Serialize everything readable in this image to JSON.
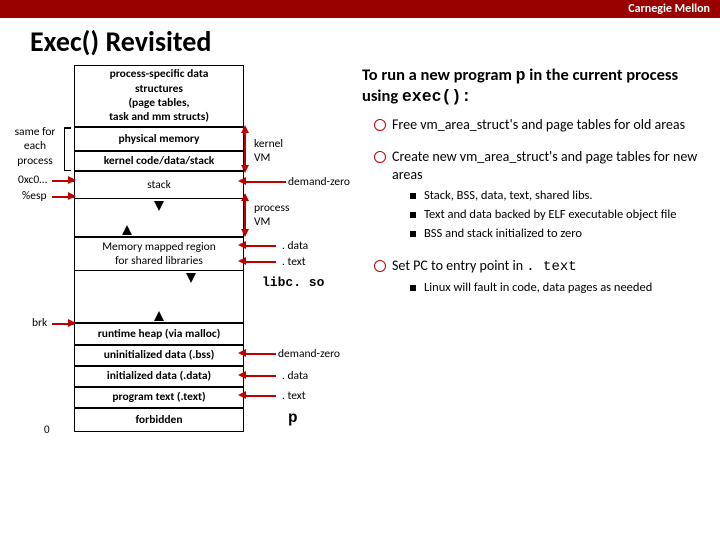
{
  "brand": "Carnegie Mellon",
  "title": "Exec() Revisited",
  "left": {
    "kvm_l1": "process-specific data",
    "kvm_l2": "structures",
    "kvm_l3": "(page tables,",
    "kvm_l4": "task and mm structs)",
    "phys": "physical memory",
    "kcds": "kernel code/data/stack",
    "ustack": "stack",
    "mmap_l1": "Memory mapped region",
    "mmap_l2": "for shared libraries",
    "heap": "runtime heap (via malloc)",
    "bss": "uninitialized data (.bss)",
    "data": "initialized data (.data)",
    "text": "program text (.text)",
    "forb": "forbidden",
    "same_for_label_l1": "same for",
    "same_for_label_l2": "each",
    "same_for_label_l3": "process",
    "oxc": "0xc0…",
    "esp": "%esp",
    "brk": "brk",
    "zero": "0",
    "kvm_label_l1": "kernel",
    "kvm_label_l2": "VM",
    "proc_label_l1": "process",
    "proc_label_l2": "VM",
    "dz": "demand-zero",
    "rdata": ". data",
    "rtext": ". text",
    "libc": "libc. so",
    "p": "p"
  },
  "right": {
    "hdr_pre": "To run a new program ",
    "hdr_p": "p",
    "hdr_mid": " in the current process using ",
    "hdr_exec": "exec():",
    "b1": "Free vm_area_struct's and page tables for old areas",
    "b2": "Create new vm_area_struct's and page tables for new areas",
    "b2a": "Stack, BSS, data, text, shared libs.",
    "b2b": "Text and data backed by ELF executable object file",
    "b2c": "BSS and stack initialized to zero",
    "b3_pre": "Set PC to entry point in ",
    "b3_text": ". text",
    "b3a": "Linux will fault in code, data pages as needed"
  }
}
